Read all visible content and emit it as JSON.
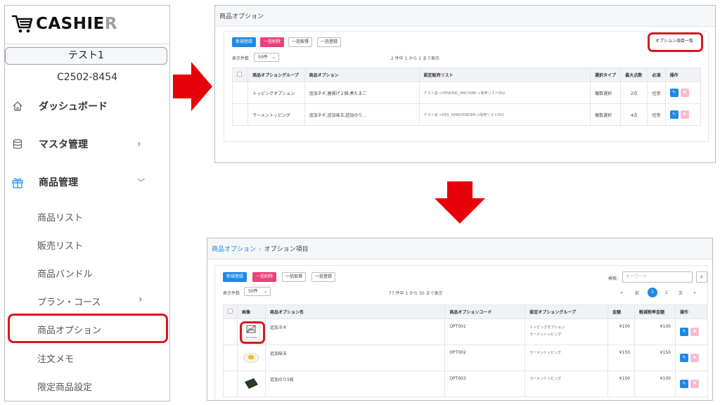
{
  "sidebar": {
    "logo": {
      "text_main": "CASHIE",
      "text_last": "R"
    },
    "store_name": "テスト1",
    "store_code": "C2502-8454",
    "nav": [
      {
        "label": "ダッシュボード",
        "icon": "home-icon"
      },
      {
        "label": "マスタ管理",
        "icon": "database-icon"
      },
      {
        "label": "商品管理",
        "icon": "gift-icon"
      }
    ],
    "sub_items": [
      "商品リスト",
      "販売リスト",
      "商品バンドル",
      "プラン・コース",
      "商品オプション",
      "注文メモ",
      "限定商品設定"
    ]
  },
  "screen1": {
    "title": "商品オプション",
    "buttons": {
      "new": "新規登録",
      "bulk_delete": "一括削除",
      "bulk_fetch": "一括取得",
      "bulk_register": "一括登録",
      "option_items": "オプション項目一覧"
    },
    "per_page_label": "表示件数",
    "per_page_value": "50件",
    "count_text": "2 件中 1 から 2 まで表示",
    "columns": [
      "商品オプショングループ",
      "商品オプション",
      "設定販売リスト",
      "選択タイプ",
      "最大点数",
      "必須",
      "操作"
    ],
    "rows": [
      [
        "トッピングオプション",
        "追加ネギ,唐揚げ２個,煮たまご",
        "テスト店->VENDING_MACHINE->販売リスト002",
        "複数選択",
        "2点",
        "任意"
      ],
      [
        "ラーメントッピング",
        "追加ネギ,追加味玉,追加のり…",
        "テスト店->OES_HANDYORDER->販売リスト001",
        "複数選択",
        "4点",
        "任意"
      ]
    ]
  },
  "screen2": {
    "breadcrumb": {
      "link": "商品オプション",
      "current": "オプション項目"
    },
    "buttons": {
      "new": "新規登録",
      "bulk_delete": "一括削除",
      "bulk_fetch": "一括取得",
      "bulk_register": "一括登録"
    },
    "search_label": "検索:",
    "search_placeholder": "キーワード",
    "per_page_label": "表示件数",
    "per_page_value": "50件",
    "count_text": "77 件中 1 から 50 まで表示",
    "pager": {
      "first": "«",
      "prev": "前",
      "page1": "1",
      "page2": "2",
      "next": "次",
      "last": "»"
    },
    "columns": [
      "画像",
      "商品オプション名",
      "商品オプションコード",
      "設定オプショングループ",
      "金額",
      "軽減税率金額",
      "操作"
    ],
    "no_image_text": "NO IMAGE",
    "rows": [
      {
        "name": "追加ネギ",
        "code": "OPT001",
        "groups": [
          "トッピングオプション",
          "ラーメントッピング"
        ],
        "price": "¥100",
        "reduced": "¥100",
        "image": "no-image"
      },
      {
        "name": "追加味玉",
        "code": "OPT002",
        "groups": [
          "ラーメントッピング"
        ],
        "price": "¥150",
        "reduced": "¥150",
        "image": "egg"
      },
      {
        "name": "追加のり5枚",
        "code": "OPT003",
        "groups": [
          "ラーメントッピング"
        ],
        "price": "¥100",
        "reduced": "¥100",
        "image": "nori"
      }
    ]
  },
  "colors": {
    "accent_red": "#d71920",
    "primary_blue": "#1e88e5",
    "pink": "#ec407a",
    "icon_blue": "#2196f3"
  }
}
